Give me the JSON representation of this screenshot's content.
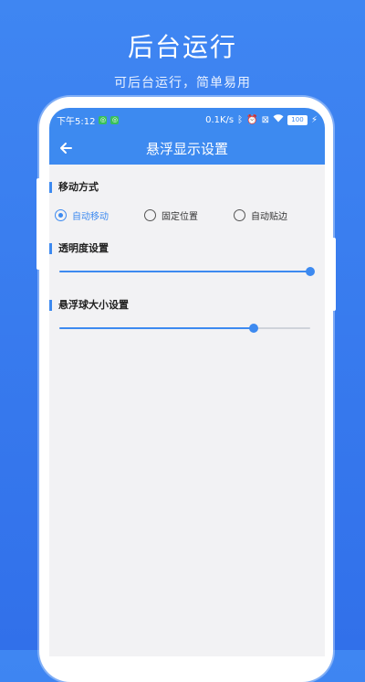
{
  "promo": {
    "title": "后台运行",
    "subtitle": "可后台运行，简单易用"
  },
  "status_bar": {
    "time": "下午5:12",
    "network_speed": "0.1K/s",
    "battery": "100"
  },
  "app_bar": {
    "title": "悬浮显示设置",
    "back_icon": "arrow-left-icon"
  },
  "movement": {
    "title": "移动方式",
    "options": [
      {
        "label": "自动移动",
        "checked": true
      },
      {
        "label": "固定位置",
        "checked": false
      },
      {
        "label": "自动贴边",
        "checked": false
      }
    ]
  },
  "transparency": {
    "title": "透明度设置",
    "value_fraction": 1.0
  },
  "ball_size": {
    "title": "悬浮球大小设置",
    "value_fraction": 0.775
  },
  "colors": {
    "accent": "#3d8af0",
    "background_top": "#3f86f2",
    "screen_bg": "#f2f2f4"
  }
}
